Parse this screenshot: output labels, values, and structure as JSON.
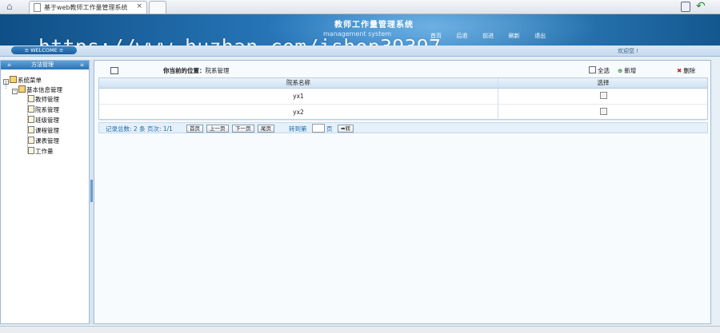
{
  "browser": {
    "tab_title": "基于web教师工作量管理系统",
    "tab_close": "×"
  },
  "header": {
    "system_title": "教师工作量管理系统",
    "system_subtitle": "management system",
    "nav": [
      "首页",
      "后退",
      "前进",
      "刷新",
      "退出"
    ],
    "watermark": "https://www.huzhan.com/ishop39397"
  },
  "welcome": {
    "button_label": "≡ WELCOME ≡",
    "user_text": "欢迎您 !"
  },
  "sidebar": {
    "title": "方法管理",
    "left_mark": "≡",
    "right_mark": "≡",
    "root": "系统菜单",
    "group": "基本信息管理",
    "items": [
      "教师管理",
      "院系管理",
      "班级管理",
      "课程管理",
      "课表管理",
      "工作量"
    ]
  },
  "main": {
    "crumb_label": "你当前的位置：",
    "crumb_value": "院系管理",
    "select_all": "全选",
    "add": "新增",
    "delete": "删除",
    "columns": [
      "院系名称",
      "选择"
    ],
    "rows": [
      {
        "name": "yx1"
      },
      {
        "name": "yx2"
      }
    ],
    "pager": {
      "info": "记录总数: 2 条  页次: 1/1",
      "first": "首页",
      "prev": "上一页",
      "next": "下一页",
      "last": "尾页",
      "goto_label": "转到第",
      "page_unit": "页",
      "go": "➡转"
    }
  },
  "colors": {
    "header_blue": "#1c6aa8",
    "accent": "#2c73b3",
    "link_blue": "#1f6aa8"
  }
}
